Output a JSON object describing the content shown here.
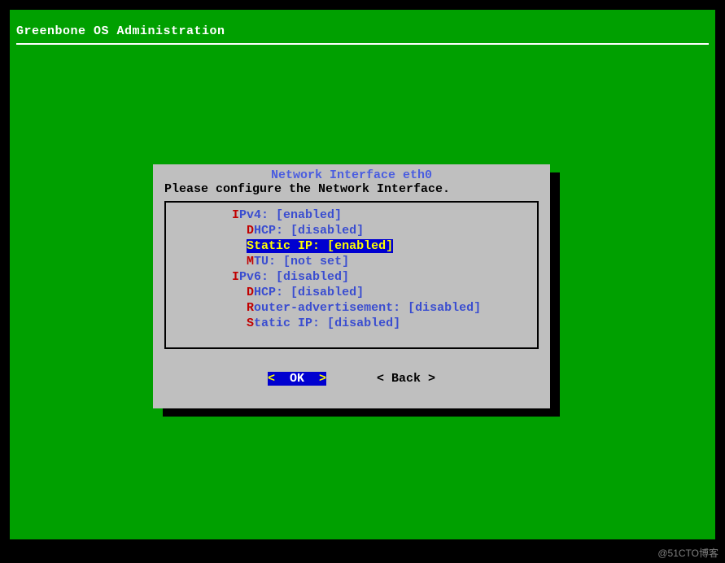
{
  "header": {
    "title": "Greenbone OS Administration"
  },
  "dialog": {
    "title": "Network Interface eth0",
    "subtitle": "Please configure the Network Interface.",
    "options": {
      "ipv4_hotkey": "I",
      "ipv4_label": "Pv4: [enabled]",
      "ipv4_dhcp_hotkey": "D",
      "ipv4_dhcp_label": "HCP: [disabled]",
      "ipv4_static_hotkey": "S",
      "ipv4_static_label": "tatic IP: [enabled]",
      "ipv4_mtu_hotkey": "M",
      "ipv4_mtu_label": "TU: [not set]",
      "ipv6_hotkey": "I",
      "ipv6_label": "Pv6: [disabled]",
      "ipv6_dhcp_hotkey": "D",
      "ipv6_dhcp_label": "HCP: [disabled]",
      "ipv6_ra_hotkey": "R",
      "ipv6_ra_label": "outer-advertisement: [disabled]",
      "ipv6_static_hotkey": "S",
      "ipv6_static_label": "tatic IP: [disabled]"
    },
    "buttons": {
      "ok": "  OK  ",
      "back": "< Back >"
    }
  },
  "watermark": "@51CTO博客"
}
